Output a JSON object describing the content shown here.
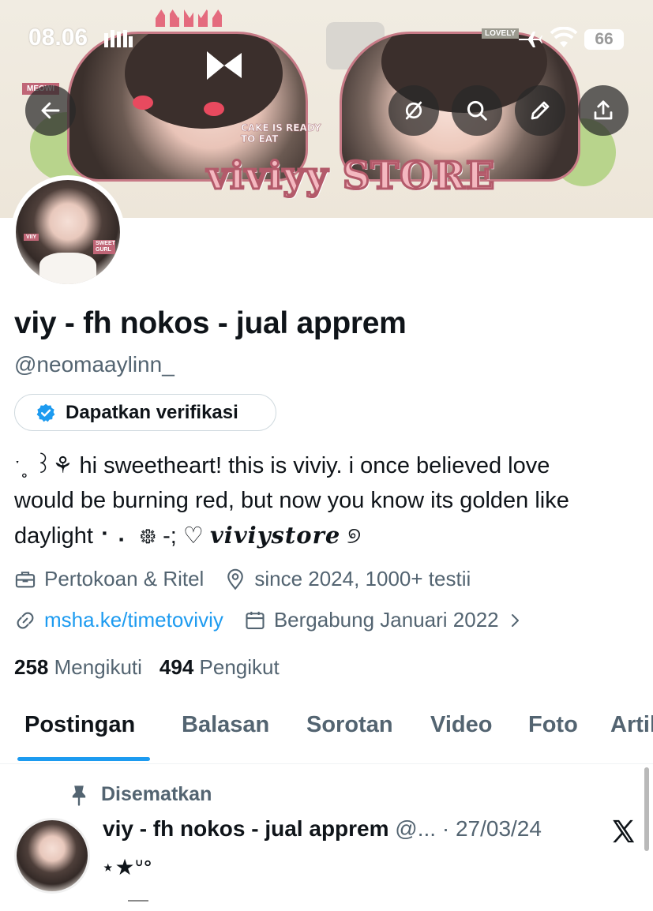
{
  "status_bar": {
    "time": "08.06",
    "battery": "66"
  },
  "banner": {
    "store_title": "viviyy STORE",
    "cake_text": "CAKE IS READY TO EAT",
    "meowi_tag": "MEOWI",
    "lovely_tag": "LOVELY"
  },
  "avatar": {
    "tag_a": "VIIY",
    "tag_b": "SWEET GURL"
  },
  "profile": {
    "display_name": "viy - fh nokos - jual apprem",
    "handle": "@neomaaylinn_",
    "verify_label": "Dapatkan verifikasi",
    "bio_line1": "ˑ˳ ꒱⚘ hi sweetheart! this is viviy. i once believed love",
    "bio_line2": "would be burning red, but now you know its golden like",
    "bio_line3_a": "daylight ⠂⠄ ᪥ -; ♡ ",
    "bio_line3_fancy": "viviystore",
    "bio_line3_b": " ୭",
    "category": "Pertokoan & Ritel",
    "location": "since 2024, 1000+ testii",
    "website": "msha.ke/timetoviviy",
    "joined": "Bergabung Januari 2022"
  },
  "stats": {
    "following_count": "258",
    "following_label": "Mengikuti",
    "followers_count": "494",
    "followers_label": "Pengikut"
  },
  "tabs": [
    {
      "label": "Postingan",
      "active": true
    },
    {
      "label": "Balasan",
      "active": false
    },
    {
      "label": "Sorotan",
      "active": false
    },
    {
      "label": "Video",
      "active": false
    },
    {
      "label": "Foto",
      "active": false
    },
    {
      "label": "Artikel",
      "active": false
    }
  ],
  "pinned_post": {
    "pinned_label": "Disematkan",
    "author_name": "viy - fh nokos - jual apprem",
    "author_handle": "@...",
    "separator": " · ",
    "date": "27/03/24",
    "text": "⋆★ᐡᐤ"
  },
  "icons": {
    "back": "arrow-left-icon",
    "hide": "eye-slash-icon",
    "search": "search-icon",
    "edit": "pencil-icon",
    "share": "share-icon",
    "verified": "verified-badge-icon",
    "category": "briefcase-icon",
    "location": "location-pin-icon",
    "link": "link-icon",
    "calendar": "calendar-icon",
    "pin": "pin-icon",
    "x_logo": "x-logo-icon"
  },
  "colors": {
    "accent": "#1d9bf0",
    "text_primary": "#0f1419",
    "text_secondary": "#536471",
    "banner_pink": "#c77a86"
  }
}
